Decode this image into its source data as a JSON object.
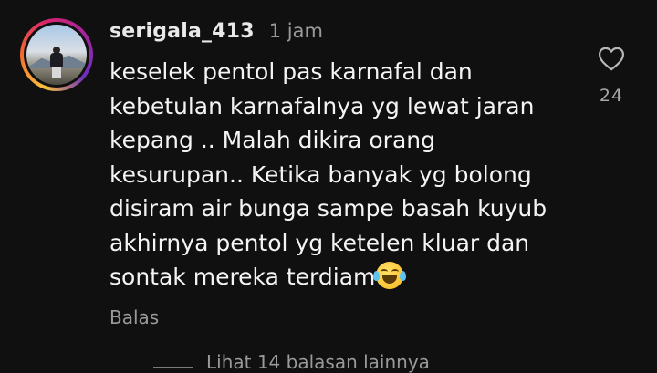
{
  "comment": {
    "username": "serigala_413",
    "time": "1 jam",
    "text_lines": [
      "keselek pentol pas karnafal dan",
      "kebetulan karnafalnya yg lewat jaran",
      "kepang .. Malah dikira orang",
      "kesurupan.. Ketika banyak yg bolong",
      "disiram air bunga sampe basah kuyub",
      "akhirnya pentol yg ketelen kluar dan",
      "sontak mereka terdiam"
    ],
    "emoji": "face-with-tears-of-joy-icon",
    "reply_label": "Balas",
    "like_icon": "heart-icon",
    "like_count": "24",
    "view_replies_label": "Lihat 14 balasan lainnya"
  },
  "colors": {
    "background": "#101010",
    "text": "#f4f4f4",
    "muted": "#9a9a9a",
    "avatar_ring": [
      "#f9c23c",
      "#f26a2e",
      "#d6246e",
      "#a2249d",
      "#6b2fc1"
    ]
  }
}
